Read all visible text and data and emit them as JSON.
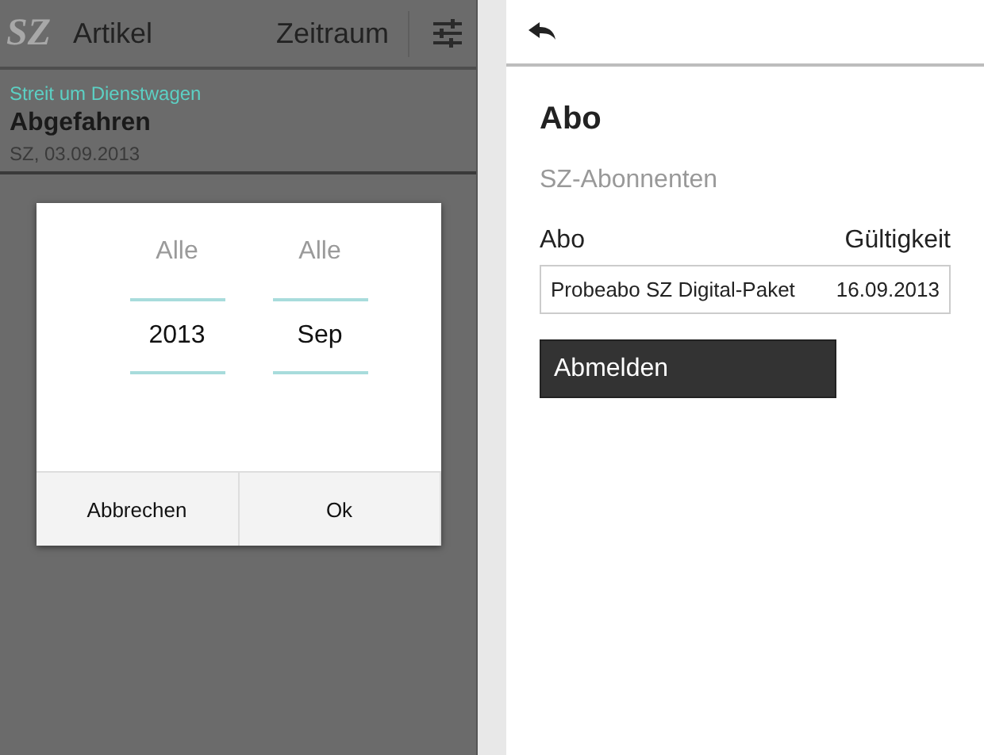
{
  "left_screen": {
    "app_bar": {
      "logo": "SZ",
      "tabs": [
        {
          "label": "Artikel",
          "selected": true
        },
        {
          "label": "Zeitraum",
          "selected": false
        }
      ]
    },
    "article": {
      "kicker": "Streit um Dienstwagen",
      "title": "Abgefahren",
      "meta": "SZ, 03.09.2013"
    },
    "dialog": {
      "pickers": [
        {
          "above": "Alle",
          "value": "2013"
        },
        {
          "above": "Alle",
          "value": "Sep"
        }
      ],
      "buttons": [
        "Abbrechen",
        "Ok"
      ]
    }
  },
  "right_screen": {
    "title": "Abo",
    "subtitle": "SZ-Abonnenten",
    "table": {
      "columns": [
        "Abo",
        "Gültigkeit"
      ],
      "rows": [
        [
          "Probeabo SZ Digital-Paket",
          "16.09.2013"
        ]
      ]
    },
    "button": "Abmelden"
  }
}
